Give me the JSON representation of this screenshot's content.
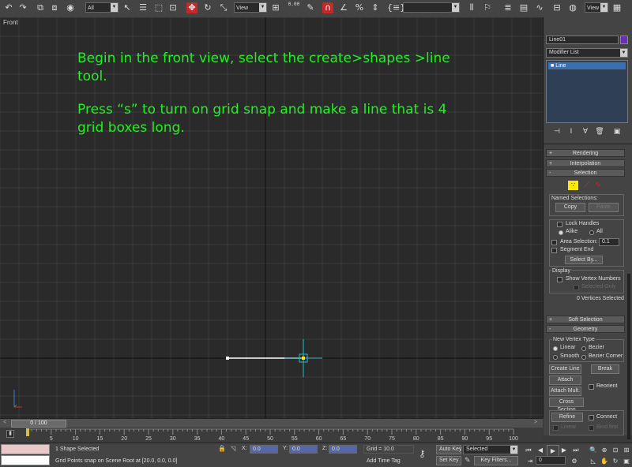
{
  "toolbar": {
    "selection_filter": "All",
    "view_dropdown": "View",
    "spinner_value": "0.00",
    "named_selection": ""
  },
  "viewport": {
    "label": "Front",
    "instruction_1": "Begin in the front view, select the create>shapes >line tool.",
    "instruction_2": "Press “s” to turn on grid snap and make a line that is 4 grid boxes long.",
    "line_length_grid_boxes": 4
  },
  "command_panel": {
    "object_name": "Line01",
    "object_color": "#6a2fb5",
    "modifier_list": "Modifier List",
    "stack_item": "Line",
    "rollouts": {
      "rendering": "Rendering",
      "interpolation": "Interpolation",
      "selection": "Selection",
      "soft_selection": "Soft Selection",
      "geometry": "Geometry"
    },
    "selection": {
      "named_selections_label": "Named Selections:",
      "copy_label": "Copy",
      "paste_label": "Paste",
      "lock_handles_label": "Lock Handles",
      "alike_label": "Alike",
      "all_label": "All",
      "area_selection_label": "Area Selection:",
      "area_selection_value": "0.1",
      "segment_end_label": "Segment End",
      "select_by_label": "Select By...",
      "display_label": "Display",
      "show_vertex_numbers_label": "Show Vertex Numbers",
      "selected_only_label": "Selected Only",
      "status": "0 Vertices Selected"
    },
    "geometry": {
      "new_vertex_type_label": "New Vertex Type",
      "linear_label": "Linear",
      "bezier_label": "Bezier",
      "smooth_label": "Smooth",
      "bezier_corner_label": "Bezier Corner",
      "create_line_label": "Create Line",
      "break_label": "Break",
      "attach_label": "Attach",
      "reorient_label": "Reorient",
      "attach_mult_label": "Attach Mult.",
      "cross_section_label": "Cross Section",
      "refine_label": "Refine",
      "connect_label": "Connect",
      "linear2_label": "Linear",
      "bind_first_label": "Bind first",
      "closed_label": "Closed",
      "bind_last_label": "Bind last"
    }
  },
  "timeline": {
    "frame_readout": "0 / 100",
    "ticks": [
      "5",
      "10",
      "15",
      "20",
      "25",
      "30",
      "35",
      "40",
      "45",
      "50",
      "55",
      "60",
      "65",
      "70",
      "75",
      "80",
      "85",
      "90",
      "95",
      "100"
    ]
  },
  "status": {
    "shapes_selected": "1 Shape Selected",
    "prompt": "Grid Points snap on Scene Root at [20.0, 0.0, 0.0]",
    "x_label": "X:",
    "x_value": "0.0",
    "y_label": "Y:",
    "y_value": "0.0",
    "z_label": "Z:",
    "z_value": "0.0",
    "grid": "Grid = 10.0",
    "add_time_tag": "Add Time Tag",
    "auto_key": "Auto Key",
    "set_key": "Set Key",
    "selected_dropdown": "Selected",
    "key_filters": "Key Filters...",
    "current_frame": "0"
  }
}
